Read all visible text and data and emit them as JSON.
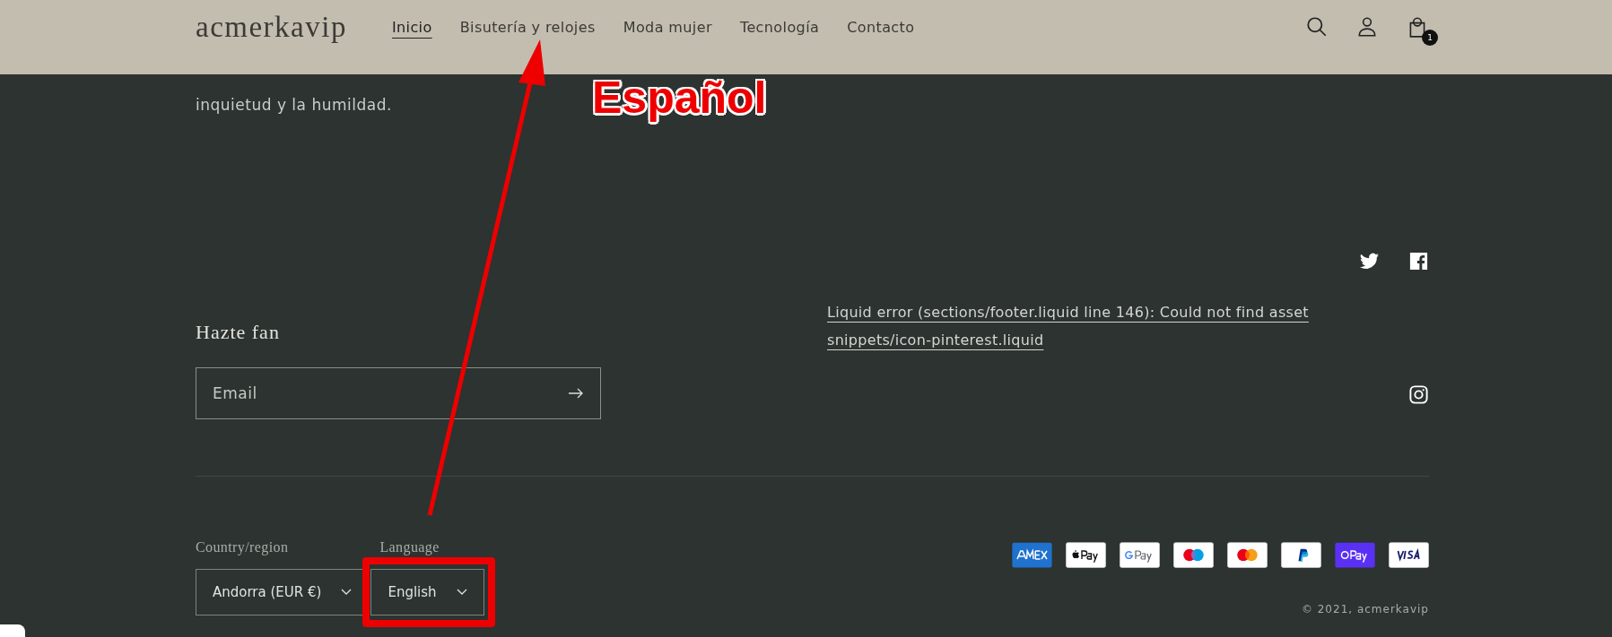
{
  "header": {
    "logo": "acmerkavip",
    "nav": [
      {
        "label": "Inicio",
        "selected": true
      },
      {
        "label": "Bisutería y relojes",
        "selected": false
      },
      {
        "label": "Moda mujer",
        "selected": false
      },
      {
        "label": "Tecnología",
        "selected": false
      },
      {
        "label": "Contacto",
        "selected": false
      }
    ],
    "cart_count": "1"
  },
  "about": {
    "lines": [
      "inquietud y la humildad."
    ]
  },
  "social": {
    "error": "Liquid error (sections/footer.liquid line 146): Could not find asset snippets/icon-pinterest.liquid"
  },
  "newsletter": {
    "heading": "Hazte fan",
    "placeholder": "Email"
  },
  "footer": {
    "selects": [
      {
        "label": "Country/region",
        "value": "Andorra (EUR €)",
        "highlighted": false
      },
      {
        "label": "Language",
        "value": "English",
        "highlighted": true
      }
    ],
    "payments": [
      {
        "kind": "amex"
      },
      {
        "kind": "applepay"
      },
      {
        "kind": "gpay"
      },
      {
        "kind": "maestro"
      },
      {
        "kind": "mastercard"
      },
      {
        "kind": "paypal"
      },
      {
        "kind": "shoppay"
      },
      {
        "kind": "visa"
      }
    ],
    "copyright": "© 2021, acmerkavip"
  },
  "annotation": {
    "text": "Español"
  }
}
